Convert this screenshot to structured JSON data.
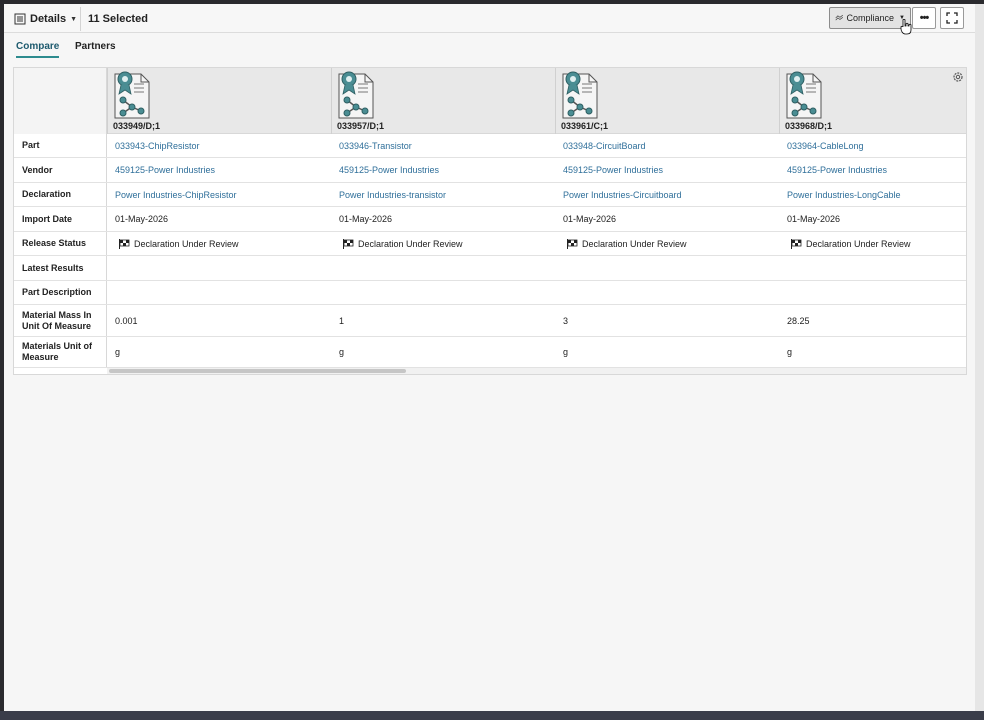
{
  "toolbar": {
    "details_label": "Details",
    "selected_count": "11 Selected",
    "compliance_label": "Compliance",
    "more_label": "•••"
  },
  "tabs": [
    {
      "label": "Compare",
      "active": true
    },
    {
      "label": "Partners",
      "active": false
    }
  ],
  "columns": [
    {
      "id": "033949/D;1"
    },
    {
      "id": "033957/D;1"
    },
    {
      "id": "033961/C;1"
    },
    {
      "id": "033968/D;1"
    }
  ],
  "rows": [
    {
      "label": "Part",
      "values": [
        "033943-ChipResistor",
        "033946-Transistor",
        "033948-CircuitBoard",
        "033964-CableLong"
      ]
    },
    {
      "label": "Vendor",
      "values": [
        "459125-Power Industries",
        "459125-Power Industries",
        "459125-Power Industries",
        "459125-Power Industries"
      ]
    },
    {
      "label": "Declaration",
      "values": [
        "Power Industries-ChipResistor",
        "Power Industries-transistor",
        "Power Industries-Circuitboard",
        "Power Industries-LongCable"
      ]
    },
    {
      "label": "Import Date",
      "values": [
        "01-May-2026",
        "01-May-2026",
        "01-May-2026",
        "01-May-2026"
      ]
    },
    {
      "label": "Release Status",
      "values": [
        "Declaration Under Review",
        "Declaration Under Review",
        "Declaration Under Review",
        "Declaration Under Review"
      ]
    },
    {
      "label": "Latest Results",
      "values": [
        "",
        "",
        "",
        ""
      ]
    },
    {
      "label": "Part Description",
      "values": [
        "",
        "",
        "",
        ""
      ]
    },
    {
      "label": "Material Mass In Unit Of Measure",
      "values": [
        "0.001",
        "1",
        "3",
        "28.25"
      ]
    },
    {
      "label": "Materials Unit of Measure",
      "values": [
        "g",
        "g",
        "g",
        "g"
      ]
    }
  ],
  "colors": {
    "link": "#2f6f9a",
    "tab_accent": "#2d8b8e",
    "icon_teal": "#4a8d93"
  }
}
